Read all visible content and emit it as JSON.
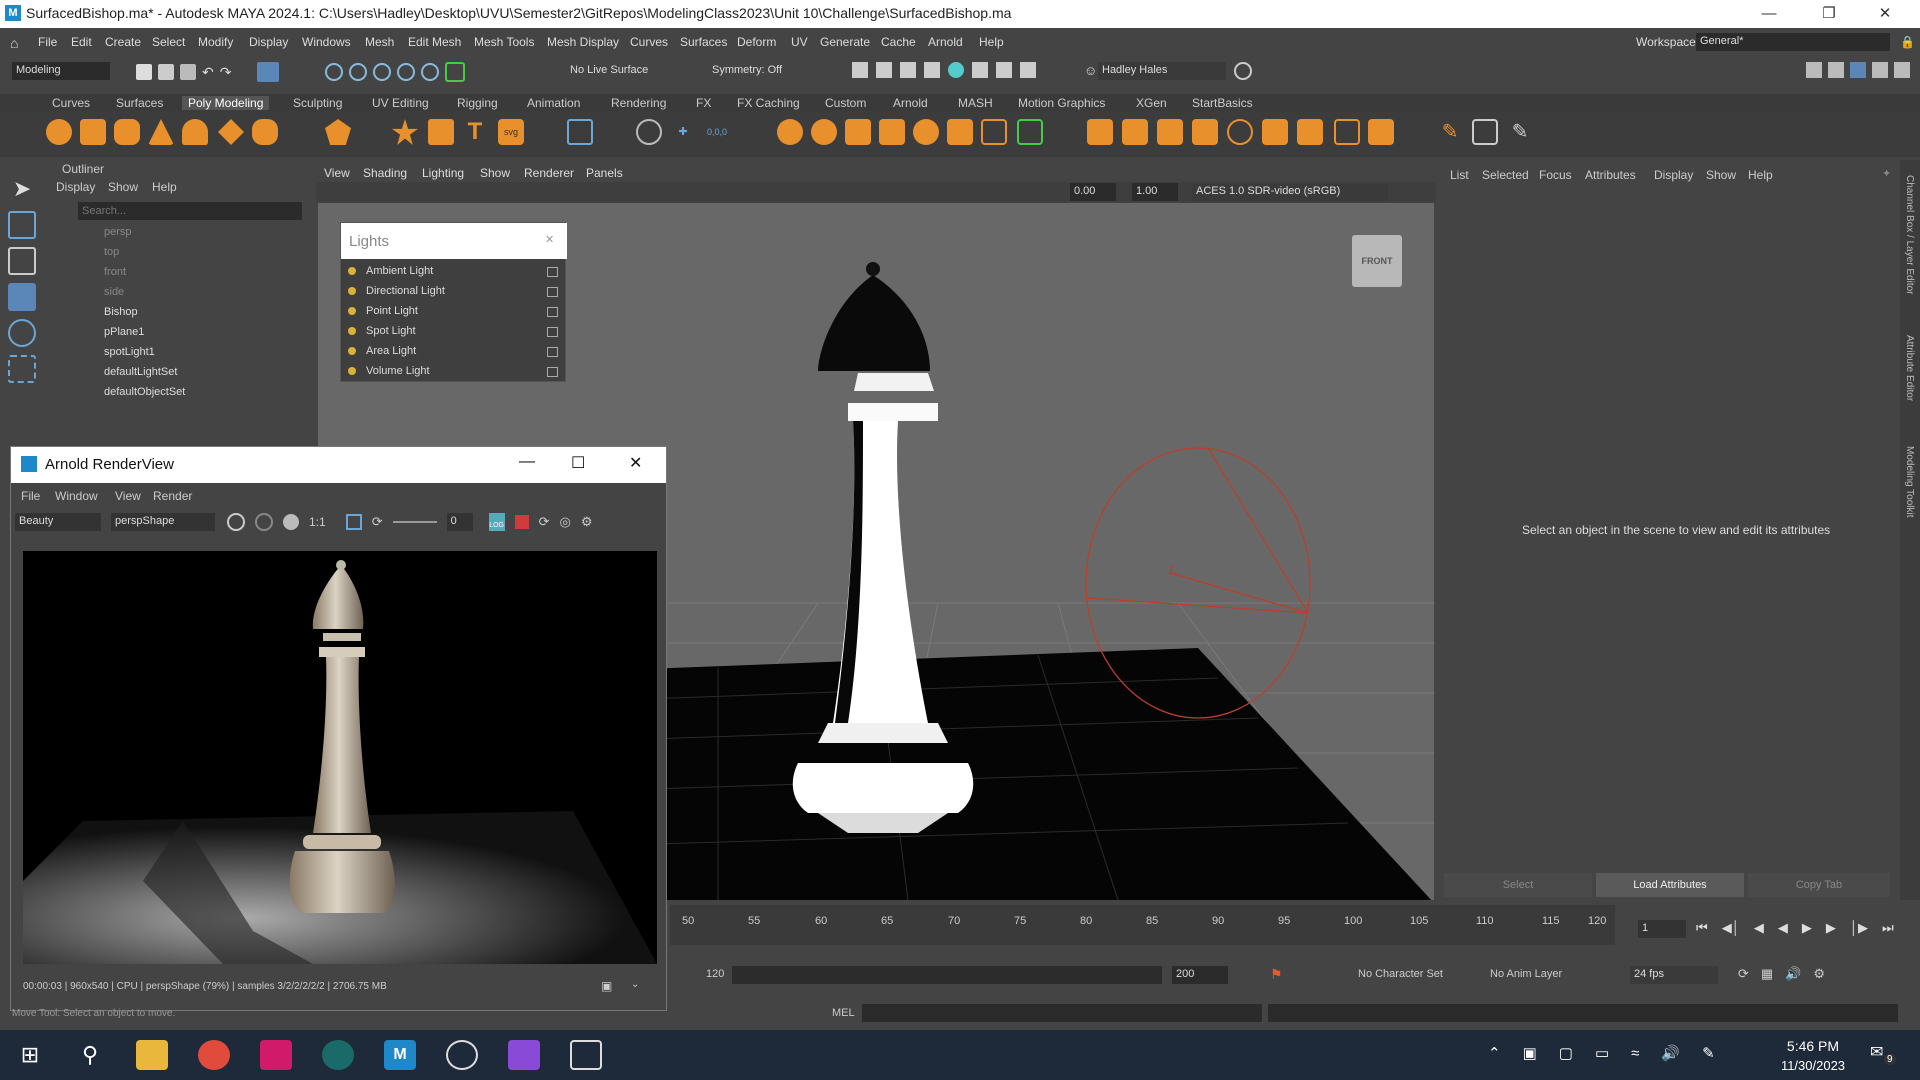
{
  "window": {
    "title": "SurfacedBishop.ma* - Autodesk MAYA 2024.1: C:\\Users\\Hadley\\Desktop\\UVU\\Semester2\\GitRepos\\ModelingClass2023\\Unit 10\\Challenge\\SurfacedBishop.ma",
    "logo": "M"
  },
  "menu": [
    "File",
    "Edit",
    "Create",
    "Select",
    "Modify",
    "Display",
    "Windows",
    "Mesh",
    "Edit Mesh",
    "Mesh Tools",
    "Mesh Display",
    "Curves",
    "Surfaces",
    "Deform",
    "UV",
    "Generate",
    "Cache",
    "Arnold",
    "Help"
  ],
  "workspace": {
    "label": "Workspace:",
    "value": "General*"
  },
  "statusline": {
    "mode": "Modeling",
    "live_surface": "No Live Surface",
    "symmetry": "Symmetry: Off",
    "user": "Hadley Hales"
  },
  "shelf_tabs": [
    "Curves",
    "Surfaces",
    "Poly Modeling",
    "Sculpting",
    "UV Editing",
    "Rigging",
    "Animation",
    "Rendering",
    "FX",
    "FX Caching",
    "Custom",
    "Arnold",
    "MASH",
    "Motion Graphics",
    "XGen",
    "StartBasics"
  ],
  "outliner": {
    "title": "Outliner",
    "menu": [
      "Display",
      "Show",
      "Help"
    ],
    "search_placeholder": "Search...",
    "items": [
      "persp",
      "top",
      "front",
      "side",
      "Bishop",
      "pPlane1",
      "spotLight1",
      "defaultLightSet",
      "defaultObjectSet"
    ]
  },
  "viewport": {
    "menu": [
      "View",
      "Shading",
      "Lighting",
      "Show",
      "Renderer",
      "Panels"
    ],
    "field1": "0.00",
    "field2": "1.00",
    "colorspace": "ACES 1.0 SDR-video (sRGB)",
    "viewcube": "FRONT"
  },
  "lights_panel": {
    "title": "Lights",
    "items": [
      "Ambient Light",
      "Directional Light",
      "Point Light",
      "Spot Light",
      "Area Light",
      "Volume Light"
    ]
  },
  "render_view": {
    "title": "Arnold RenderView",
    "menu": [
      "File",
      "Window",
      "View",
      "Render"
    ],
    "aov": "Beauty",
    "camera": "perspShape",
    "ratio": "1:1",
    "exposure": "0",
    "log": "LOG",
    "status": "00:00:03 | 960x540 | CPU | perspShape (79%) | samples 3/2/2/2/2/2 | 2706.75 MB"
  },
  "attribute_editor": {
    "menu": [
      "List",
      "Selected",
      "Focus",
      "Attributes",
      "Display",
      "Show",
      "Help"
    ],
    "message": "Select an object in the scene to view and edit its attributes",
    "buttons": [
      "Select",
      "Load Attributes",
      "Copy Tab"
    ]
  },
  "side_tabs": [
    "Channel Box / Layer Editor",
    "Attribute Editor",
    "Modeling Toolkit"
  ],
  "timeline": {
    "ticks": [
      "50",
      "55",
      "60",
      "65",
      "70",
      "75",
      "80",
      "85",
      "90",
      "95",
      "100",
      "105",
      "110",
      "115",
      "120"
    ],
    "current_frame": "1"
  },
  "range": {
    "start": "120",
    "end": "200",
    "char_set": "No Character Set",
    "anim_layer": "No Anim Layer",
    "fps": "24 fps"
  },
  "cmdline": {
    "label": "MEL"
  },
  "help_line": "Move Tool: Select an object to move.",
  "taskbar": {
    "time": "5:46 PM",
    "date": "11/30/2023",
    "notifications": "9"
  }
}
